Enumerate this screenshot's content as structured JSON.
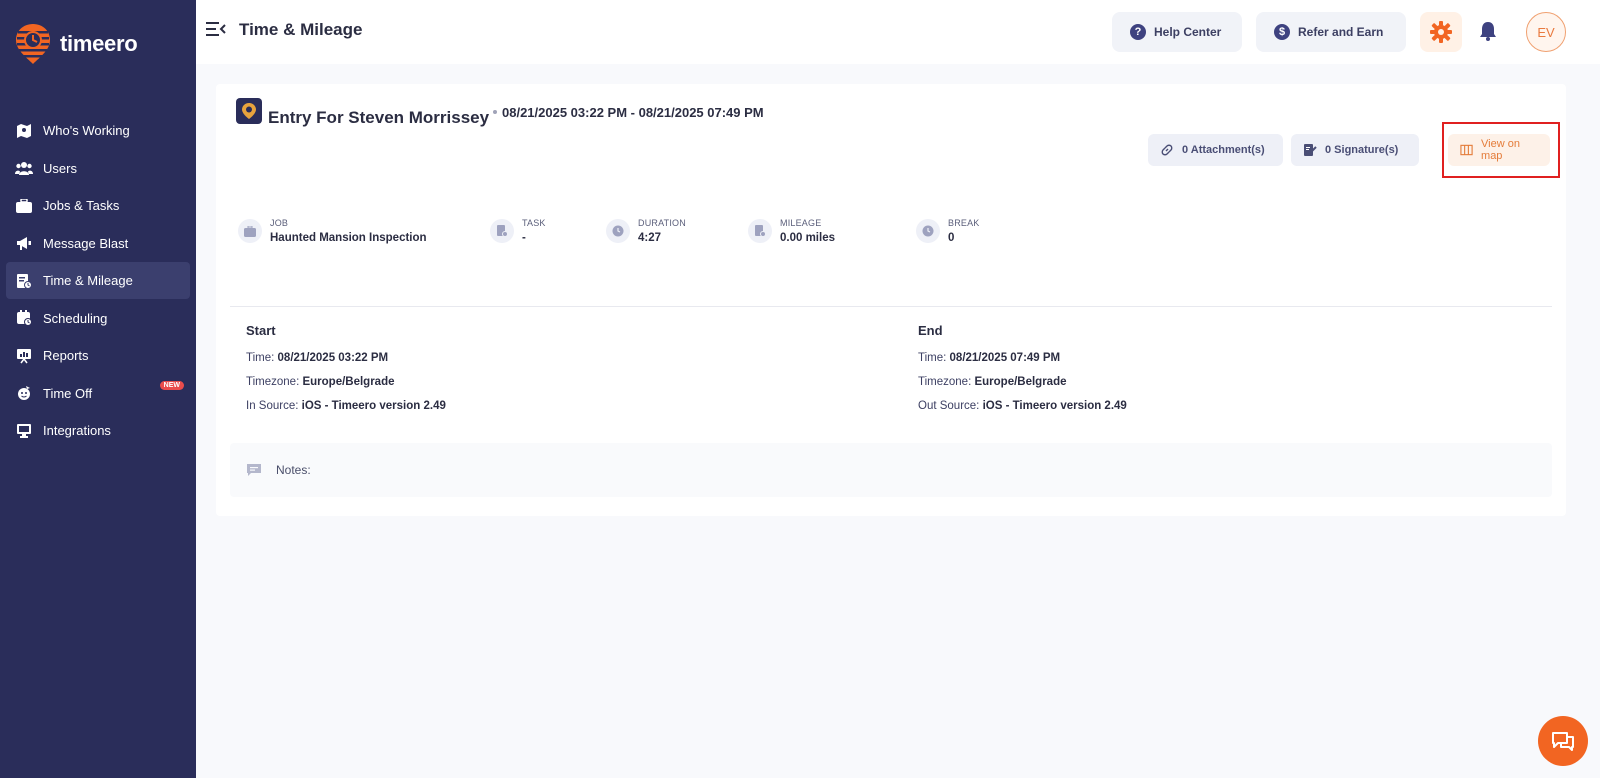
{
  "app": {
    "logo_text": "timeero"
  },
  "sidebar": {
    "items": [
      {
        "label": "Who's Working",
        "icon": "map-icon"
      },
      {
        "label": "Users",
        "icon": "users-icon"
      },
      {
        "label": "Jobs & Tasks",
        "icon": "briefcase-icon"
      },
      {
        "label": "Message Blast",
        "icon": "megaphone-icon"
      },
      {
        "label": "Time & Mileage",
        "icon": "timesheet-icon",
        "active": true
      },
      {
        "label": "Scheduling",
        "icon": "calendar-icon"
      },
      {
        "label": "Reports",
        "icon": "presentation-icon"
      },
      {
        "label": "Time Off",
        "icon": "beach-icon",
        "badge": "NEW"
      },
      {
        "label": "Integrations",
        "icon": "monitor-icon"
      }
    ]
  },
  "header": {
    "title": "Time & Mileage",
    "help_label": "Help Center",
    "refer_label": "Refer and Earn",
    "avatar_initials": "EV"
  },
  "entry": {
    "title": "Entry For Steven Morrissey",
    "range": "08/21/2025 03:22 PM - 08/21/2025 07:49 PM",
    "attachments_label": "0 Attachment(s)",
    "signatures_label": "0 Signature(s)",
    "map_label": "View on map"
  },
  "stats": {
    "job": {
      "label": "JOB",
      "value": "Haunted Mansion Inspection"
    },
    "task": {
      "label": "TASK",
      "value": "-"
    },
    "duration": {
      "label": "DURATION",
      "value": "4:27"
    },
    "mileage": {
      "label": "MILEAGE",
      "value": "0.00 miles"
    },
    "break": {
      "label": "BREAK",
      "value": "0"
    }
  },
  "start": {
    "title": "Start",
    "time_label": "Time:",
    "time_value": "08/21/2025 03:22 PM",
    "tz_label": "Timezone:",
    "tz_value": "Europe/Belgrade",
    "source_label": "In Source:",
    "source_value": "iOS - Timeero version 2.49"
  },
  "end": {
    "title": "End",
    "time_label": "Time:",
    "time_value": "08/21/2025 07:49 PM",
    "tz_label": "Timezone:",
    "tz_value": "Europe/Belgrade",
    "source_label": "Out Source:",
    "source_value": "iOS - Timeero version 2.49"
  },
  "notes": {
    "label": "Notes:"
  },
  "colors": {
    "sidebar_bg": "#2a2d5a",
    "accent_orange": "#f26522",
    "highlight_red": "#e02020"
  }
}
